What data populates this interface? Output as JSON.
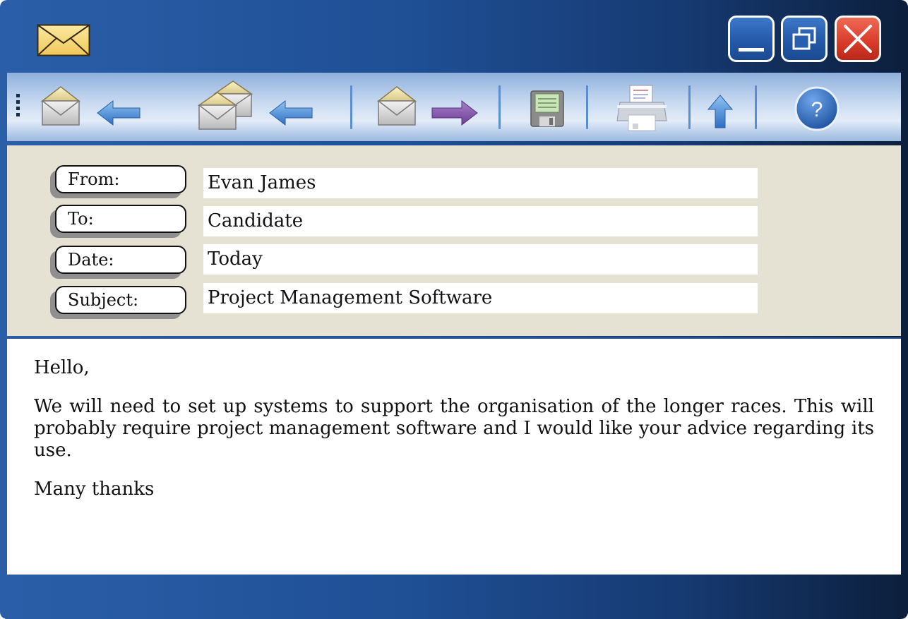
{
  "window": {
    "icon": "envelope-icon",
    "controls": [
      "minimize-icon",
      "restore-icon",
      "close-icon"
    ]
  },
  "toolbar": {
    "buttons": [
      {
        "name": "reply-button",
        "icon": "reply-icon"
      },
      {
        "name": "reply-all-button",
        "icon": "reply-all-icon"
      },
      {
        "name": "forward-button",
        "icon": "forward-icon"
      },
      {
        "name": "save-button",
        "icon": "save-icon"
      },
      {
        "name": "print-button",
        "icon": "print-icon"
      },
      {
        "name": "up-button",
        "icon": "up-arrow-icon"
      },
      {
        "name": "help-button",
        "icon": "help-icon",
        "glyph": "?"
      }
    ]
  },
  "header": {
    "from_label": "From:",
    "from_value": "Evan James",
    "to_label": "To:",
    "to_value": "Candidate",
    "date_label": "Date:",
    "date_value": "Today",
    "subject_label": "Subject:",
    "subject_value": "Project Management Software"
  },
  "message": {
    "greeting": "Hello,",
    "paragraph": "We will need to set up systems to support the organisation of the longer races. This will probably require project management software and I would like your advice regarding its use.",
    "signoff": "Many thanks"
  },
  "colors": {
    "title_bar_start": "#2a5fa8",
    "title_bar_end": "#0c1f3c",
    "toolbar": "#c9dbf1",
    "header_panel": "#e5e2d3",
    "close_button": "#d83a28",
    "forward_arrow": "#7b4fa0",
    "back_arrow": "#3f7fd0"
  }
}
